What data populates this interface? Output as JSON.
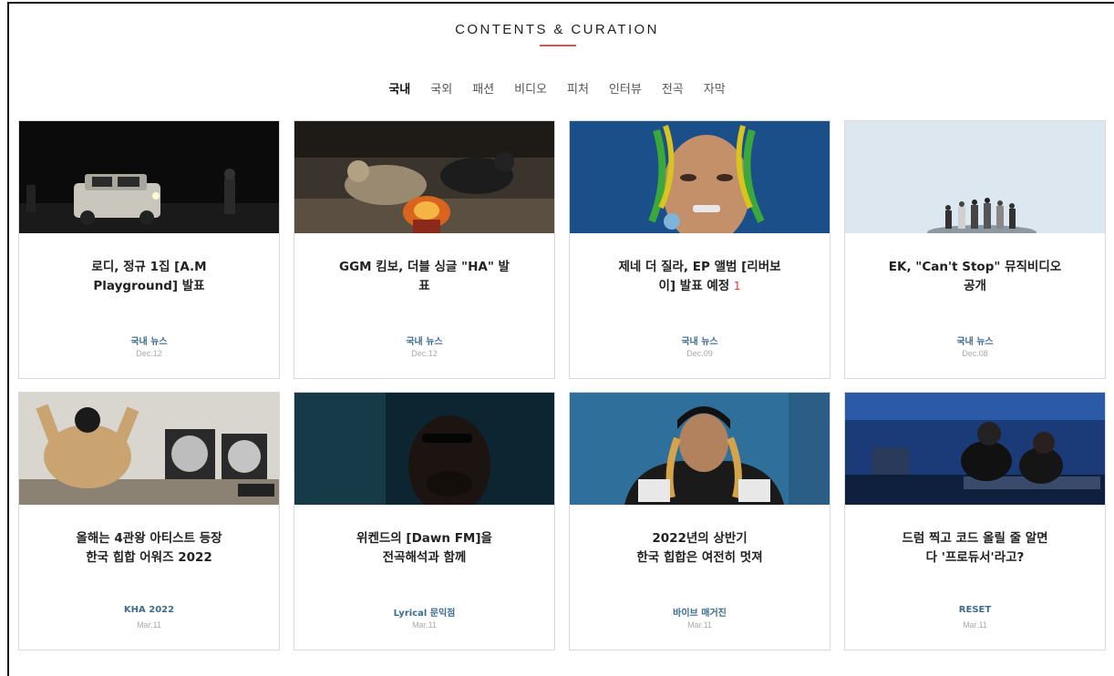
{
  "header": {
    "title": "CONTENTS & CURATION"
  },
  "tabs": [
    {
      "label": "국내",
      "active": true
    },
    {
      "label": "국외"
    },
    {
      "label": "패션"
    },
    {
      "label": "비디오"
    },
    {
      "label": "피처"
    },
    {
      "label": "인터뷰"
    },
    {
      "label": "전곡"
    },
    {
      "label": "자막"
    }
  ],
  "cards": [
    {
      "title_line1": "로디, 정규 1집 [A.M",
      "title_line2": "Playground] 발표",
      "comment_count": "",
      "category": "국내 뉴스",
      "date": "Dec.12",
      "image": "night-car-photo"
    },
    {
      "title_line1": "GGM 킴보, 더블 싱글 \"HA\" 발",
      "title_line2": "표",
      "comment_count": "",
      "category": "국내 뉴스",
      "date": "Dec.12",
      "image": "dogs-fire-artwork"
    },
    {
      "title_line1": "제네 더 질라, EP 앨범 [리버보",
      "title_line2": "이] 발표 예정",
      "comment_count": "1",
      "category": "국내 뉴스",
      "date": "Dec.09",
      "image": "braids-portrait-photo"
    },
    {
      "title_line1": "EK, \"Can't Stop\" 뮤직비디오",
      "title_line2": "공개",
      "comment_count": "",
      "category": "국내 뉴스",
      "date": "Dec.08",
      "image": "group-skyline-photo"
    },
    {
      "title_line1": "올해는 4관왕 아티스트 등장",
      "title_line2": "한국 힙합 어워즈 2022",
      "comment_count": "",
      "category": "KHA 2022",
      "date": "Mar.11",
      "image": "masked-artist-plaques-photo"
    },
    {
      "title_line1": "위켄드의 [Dawn FM]을",
      "title_line2": "전곡해석과 함께",
      "comment_count": "",
      "category": "Lyrical 문익점",
      "date": "Mar.11",
      "image": "dark-portrait-photo"
    },
    {
      "title_line1": "2022년의 상반기",
      "title_line2": "한국 힙합은 여전히 멋져",
      "comment_count": "",
      "category": "바이브 매거진",
      "date": "Mar.11",
      "image": "beanie-portrait-photo"
    },
    {
      "title_line1": "드럼 찍고 코드 올릴 줄 알면",
      "title_line2": "다 '프로듀서'라고?",
      "comment_count": "",
      "category": "RESET",
      "date": "Mar.11",
      "image": "studio-producers-photo"
    }
  ],
  "colors": {
    "accent": "#d9534f",
    "category_text": "#3e6c8f",
    "date_text": "#aaaaaa",
    "comment_count": "#e33333"
  }
}
